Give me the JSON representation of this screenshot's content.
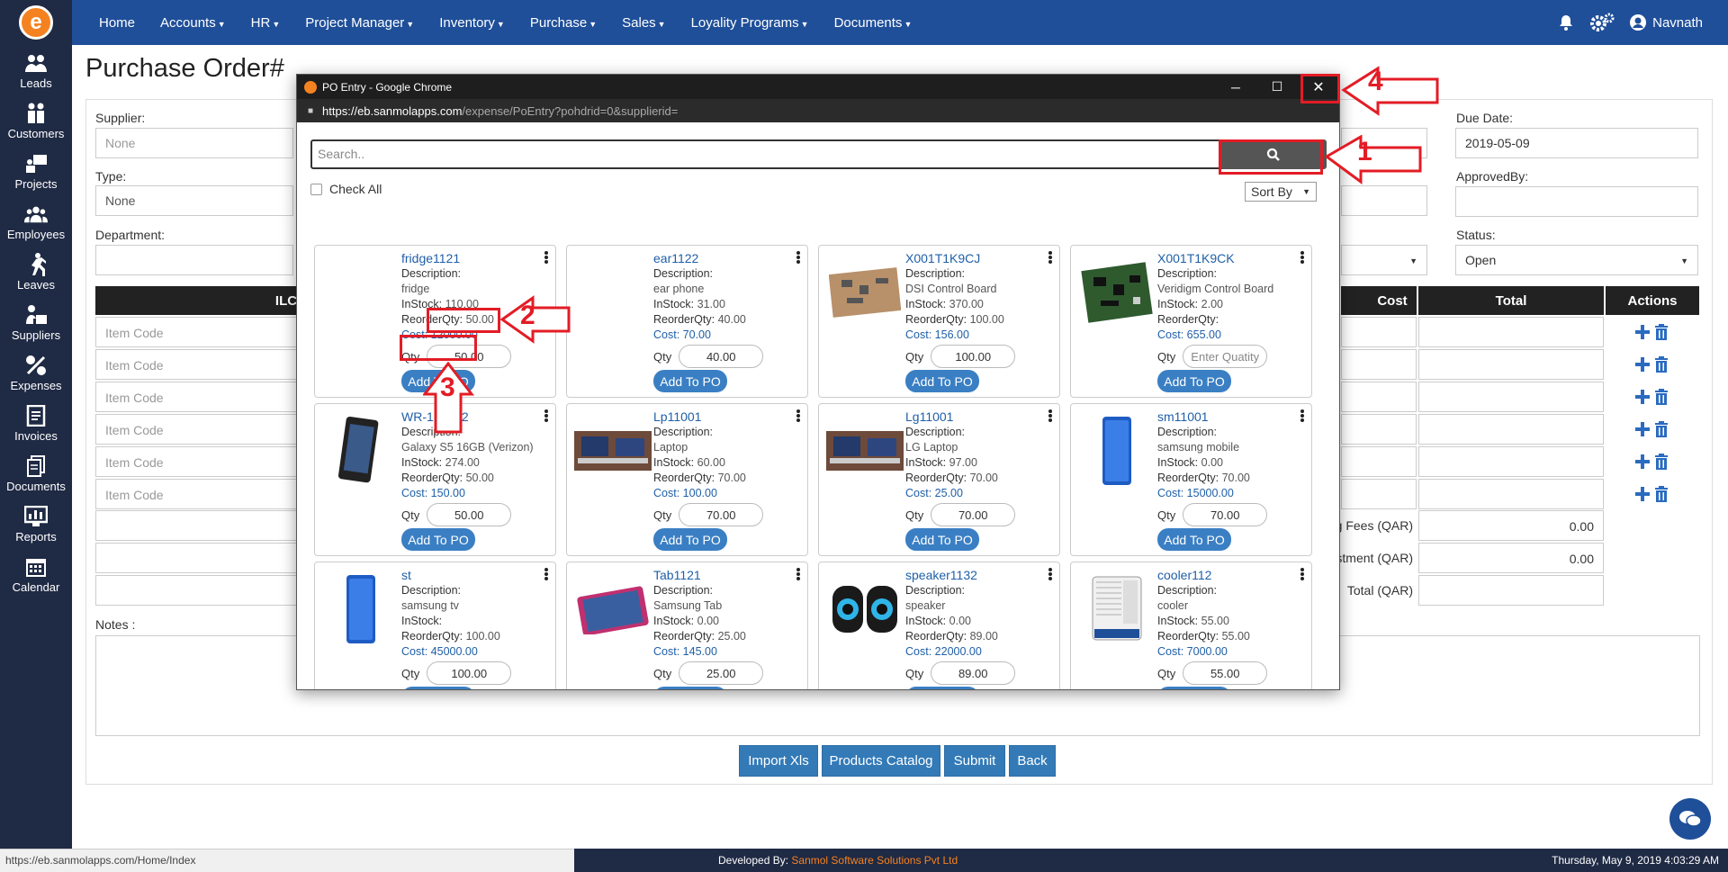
{
  "nav": {
    "items": [
      {
        "label": "Home",
        "caret": false
      },
      {
        "label": "Accounts",
        "caret": true
      },
      {
        "label": "HR",
        "caret": true
      },
      {
        "label": "Project Manager",
        "caret": true
      },
      {
        "label": "Inventory",
        "caret": true
      },
      {
        "label": "Purchase",
        "caret": true
      },
      {
        "label": "Sales",
        "caret": true
      },
      {
        "label": "Loyality Programs",
        "caret": true
      },
      {
        "label": "Documents",
        "caret": true
      }
    ],
    "user": "Navnath"
  },
  "sidebar": {
    "items": [
      {
        "label": "Leads",
        "icon": "leads-icon"
      },
      {
        "label": "Customers",
        "icon": "customers-icon"
      },
      {
        "label": "Projects",
        "icon": "projects-icon"
      },
      {
        "label": "Employees",
        "icon": "employees-icon"
      },
      {
        "label": "Leaves",
        "icon": "leaves-icon"
      },
      {
        "label": "Suppliers",
        "icon": "suppliers-icon"
      },
      {
        "label": "Expenses",
        "icon": "expenses-icon"
      },
      {
        "label": "Invoices",
        "icon": "invoices-icon"
      },
      {
        "label": "Documents",
        "icon": "documents-icon"
      },
      {
        "label": "Reports",
        "icon": "reports-icon"
      },
      {
        "label": "Calendar",
        "icon": "calendar-icon"
      }
    ]
  },
  "page": {
    "title": "Purchase Order#",
    "supplier_label": "Supplier:",
    "supplier_value": "None",
    "type_label": "Type:",
    "type_value": "None",
    "department_label": "Department:",
    "due_date_label": "Due Date:",
    "due_date_value": "2019-05-09",
    "approved_by_label": "ApprovedBy:",
    "status_label": "Status:",
    "status_value": "Open",
    "grid_headers": {
      "ilc": "ILC",
      "cost": "Cost",
      "total": "Total",
      "actions": "Actions"
    },
    "item_code_placeholder": "Item Code",
    "summary": [
      {
        "label": "g Fees (QAR)",
        "value": "0.00"
      },
      {
        "label": "stment (QAR)",
        "value": "0.00"
      },
      {
        "label": "Total (QAR)",
        "value": ""
      }
    ],
    "notes_label": "Notes :",
    "buttons": {
      "import": "Import Xls",
      "catalog": "Products Catalog",
      "submit": "Submit",
      "back": "Back"
    }
  },
  "popup": {
    "title": "PO Entry - Google Chrome",
    "url_host": "https://eb.sanmolapps.com",
    "url_path": "/expense/PoEntry?pohdrid=0&supplierid=",
    "search_placeholder": "Search..",
    "check_all": "Check All",
    "sort_by": "Sort By",
    "labels": {
      "description": "Description:",
      "instock": "InStock:",
      "reorder": "ReorderQty:",
      "cost": "Cost:",
      "qty": "Qty",
      "add": "Add To PO",
      "qty_placeholder": "Enter Quatity"
    },
    "products": [
      {
        "name": "fridge1121",
        "desc": "fridge",
        "instock": "110.00",
        "reorder": "50.00",
        "cost": "12000.00",
        "qty": "50.00",
        "img": "blank"
      },
      {
        "name": "ear1122",
        "desc": "ear phone",
        "instock": "31.00",
        "reorder": "40.00",
        "cost": "70.00",
        "qty": "40.00",
        "img": "blank"
      },
      {
        "name": "X001T1K9CJ",
        "desc": "DSI Control Board",
        "instock": "370.00",
        "reorder": "100.00",
        "cost": "156.00",
        "qty": "100.00",
        "img": "board-tan"
      },
      {
        "name": "X001T1K9CK",
        "desc": "Veridigm Control Board",
        "instock": "2.00",
        "reorder": "",
        "cost": "655.00",
        "qty": "",
        "img": "board-green"
      },
      {
        "name": "WR-194242",
        "desc": "Galaxy S5 16GB (Verizon)",
        "instock": "274.00",
        "reorder": "50.00",
        "cost": "150.00",
        "qty": "50.00",
        "img": "phone-black"
      },
      {
        "name": "Lp11001",
        "desc": "Laptop",
        "instock": "60.00",
        "reorder": "70.00",
        "cost": "100.00",
        "qty": "70.00",
        "img": "laptop"
      },
      {
        "name": "Lg11001",
        "desc": "LG Laptop",
        "instock": "97.00",
        "reorder": "70.00",
        "cost": "25.00",
        "qty": "70.00",
        "img": "laptop"
      },
      {
        "name": "sm11001",
        "desc": "samsung mobile",
        "instock": "0.00",
        "reorder": "70.00",
        "cost": "15000.00",
        "qty": "70.00",
        "img": "phone-blue"
      },
      {
        "name": "st",
        "desc": "samsung tv",
        "instock": "",
        "reorder": "100.00",
        "cost": "45000.00",
        "qty": "100.00",
        "img": "phone-blue"
      },
      {
        "name": "Tab1121",
        "desc": "Samsung Tab",
        "instock": "0.00",
        "reorder": "25.00",
        "cost": "145.00",
        "qty": "25.00",
        "img": "tablet"
      },
      {
        "name": "speaker1132",
        "desc": "speaker",
        "instock": "0.00",
        "reorder": "89.00",
        "cost": "22000.00",
        "qty": "89.00",
        "img": "speaker"
      },
      {
        "name": "cooler112",
        "desc": "cooler",
        "instock": "55.00",
        "reorder": "55.00",
        "cost": "7000.00",
        "qty": "55.00",
        "img": "cooler"
      }
    ]
  },
  "annotations": {
    "n1": "1",
    "n2": "2",
    "n3": "3",
    "n4": "4",
    "color": "#e31c25"
  },
  "footer": {
    "status_url": "https://eb.sanmolapps.com/Home/Index",
    "developed_by": "Developed By:",
    "company": "Sanmol Software Solutions Pvt Ltd",
    "timestamp": "Thursday, May 9, 2019 4:03:29 AM"
  },
  "colors": {
    "nav": "#1f4f99",
    "sidebar": "#1f2a44",
    "button": "#337ab7",
    "accent": "#f58220"
  }
}
